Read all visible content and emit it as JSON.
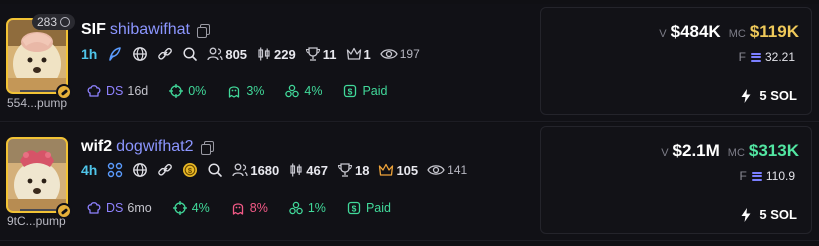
{
  "tokens": [
    {
      "holder_count": "283",
      "address": "554...pump",
      "symbol": "SIF",
      "name": "shibawifhat",
      "age": "1h",
      "holders": "805",
      "trades": "229",
      "top_holders": "11",
      "crown": "1",
      "views": "197",
      "dev_sold_label": "DS",
      "dev_sold_age": "16d",
      "target_pct": "0%",
      "insider_pct": "3%",
      "bundle_pct": "4%",
      "paid_label": "Paid",
      "volume_label": "V",
      "volume": "$484K",
      "mc_label": "MC",
      "mc": "$119K",
      "mc_color": "#efc95a",
      "fee_label": "F",
      "fee": "32.21",
      "buy_amount": "5 SOL",
      "icons": [
        "copy-icon",
        "feather-icon",
        "globe-icon",
        "link-icon",
        "search-icon",
        "users-icon",
        "candles-icon",
        "trophy-icon",
        "crown-icon",
        "eye-icon"
      ]
    },
    {
      "holder_count": "",
      "address": "9tC...pump",
      "symbol": "wif2",
      "name": "dogwifhat2",
      "age": "4h",
      "holders": "1680",
      "trades": "467",
      "top_holders": "18",
      "crown": "105",
      "views": "141",
      "dev_sold_label": "DS",
      "dev_sold_age": "6mo",
      "target_pct": "4%",
      "insider_pct": "8%",
      "bundle_pct": "1%",
      "paid_label": "Paid",
      "volume_label": "V",
      "volume": "$2.1M",
      "mc_label": "MC",
      "mc": "$313K",
      "mc_color": "#52e6a2",
      "fee_label": "F",
      "fee": "110.9",
      "buy_amount": "5 SOL",
      "icons": [
        "copy-icon",
        "community-icon",
        "globe-icon",
        "link-icon",
        "coin-icon",
        "search-icon",
        "users-icon",
        "candles-icon",
        "trophy-icon",
        "crown-icon",
        "eye-icon"
      ]
    }
  ],
  "colors": {
    "background": "#101014",
    "age": "#4fc5ea",
    "name": "#8c96ff",
    "green": "#41d99a",
    "pink": "#f45a87",
    "avatar_border": "#f2c335"
  }
}
